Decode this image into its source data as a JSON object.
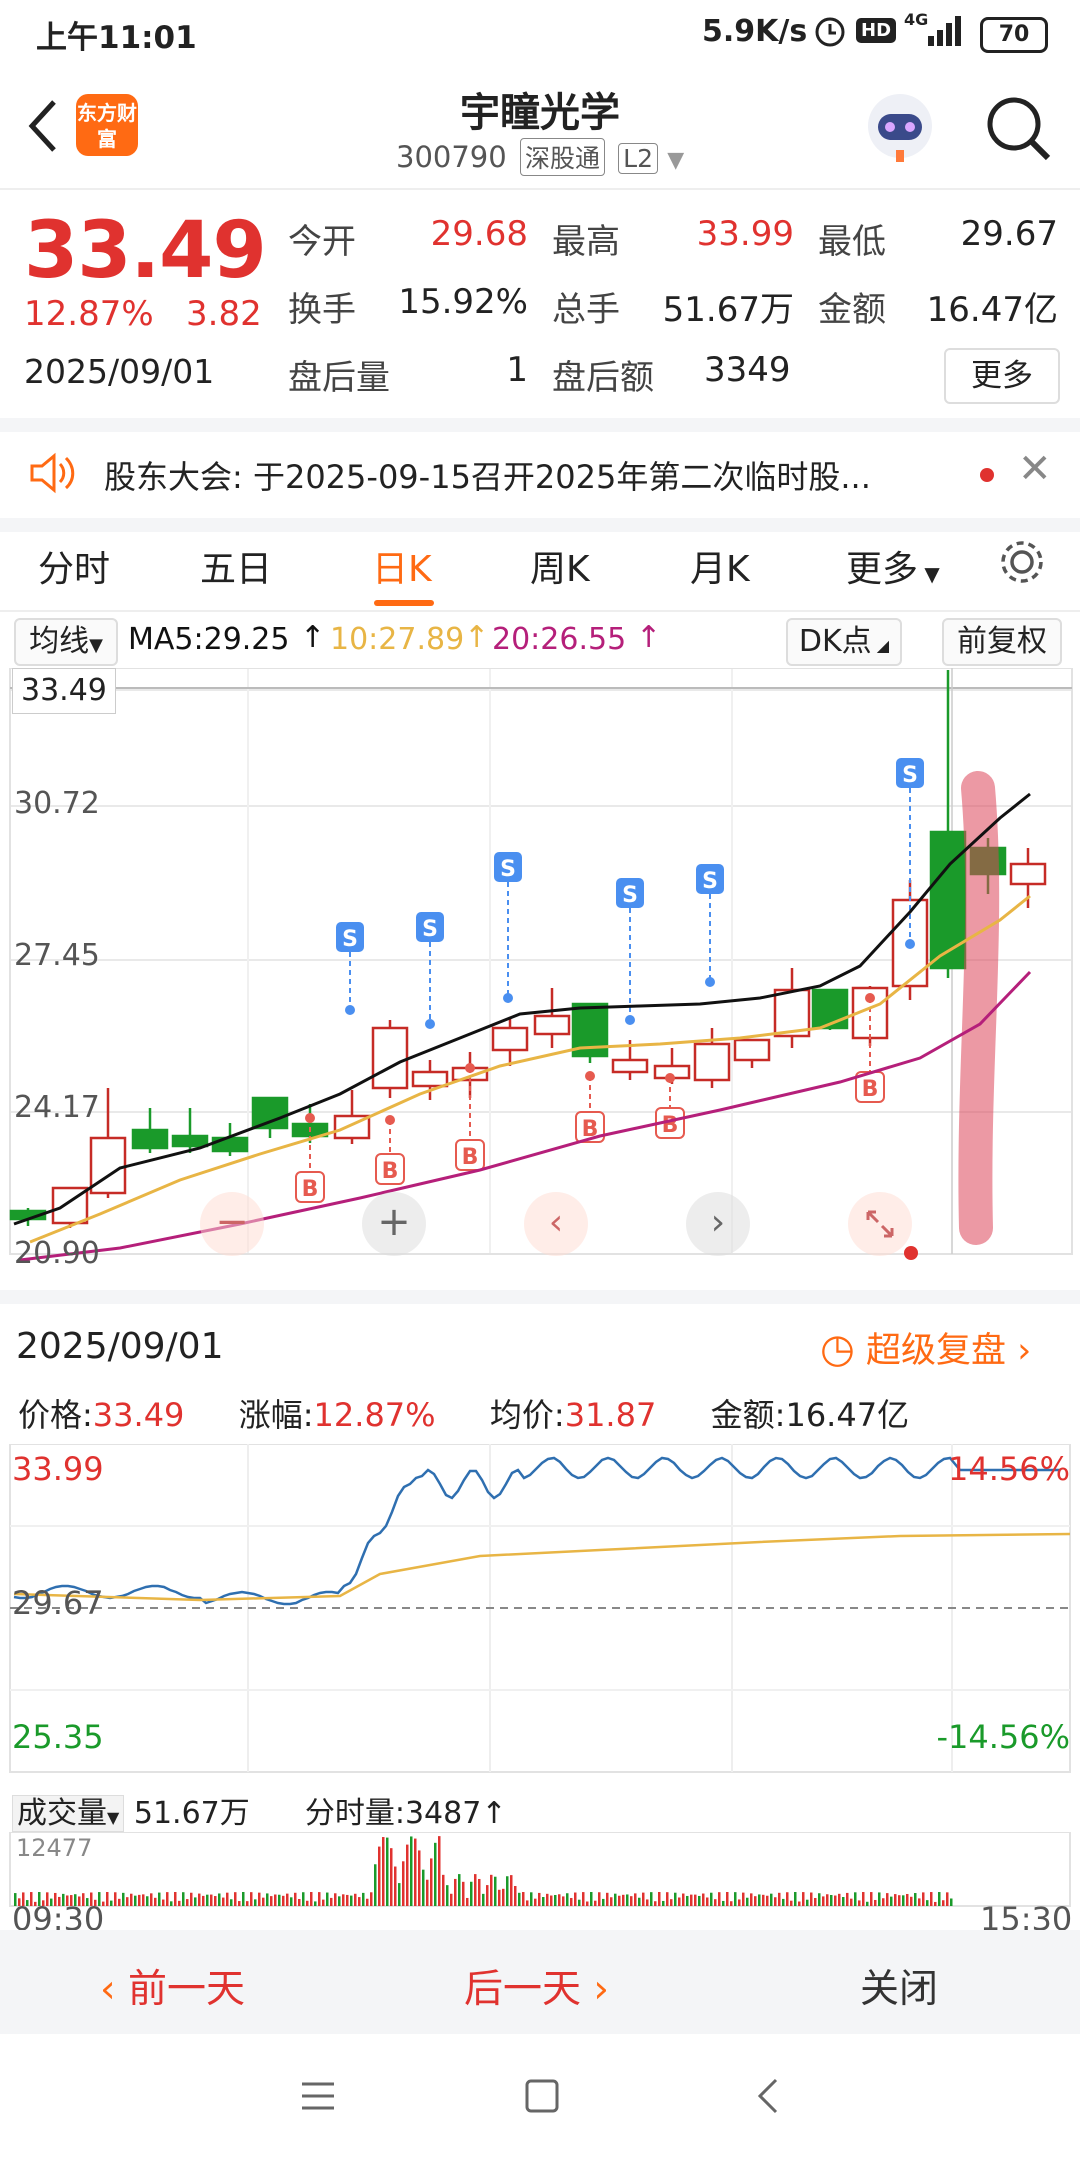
{
  "status_bar": {
    "time": "上午11:01",
    "net_speed": "5.9K/s",
    "hd": "HD",
    "network": "4G",
    "battery": "70"
  },
  "header": {
    "logo_text": "东方财富",
    "title": "宇瞳光学",
    "code": "300790",
    "tag_connect": "深股通",
    "tag_level": "L2"
  },
  "quote": {
    "price": "33.49",
    "change_pct": "12.87%",
    "change": "3.82",
    "date": "2025/09/01",
    "open_label": "今开",
    "open": "29.68",
    "high_label": "最高",
    "high": "33.99",
    "low_label": "最低",
    "low": "29.67",
    "turnover_label": "换手",
    "turnover": "15.92%",
    "volume_label": "总手",
    "volume": "51.67万",
    "amount_label": "金额",
    "amount": "16.47亿",
    "after_vol_label": "盘后量",
    "after_vol": "1",
    "after_amt_label": "盘后额",
    "after_amt": "3349",
    "more": "更多"
  },
  "notice": {
    "text": "股东大会: 于2025-09-15召开2025年第二次临时股..."
  },
  "tabs": [
    {
      "label": "分时"
    },
    {
      "label": "五日"
    },
    {
      "label": "日K"
    },
    {
      "label": "周K"
    },
    {
      "label": "月K"
    },
    {
      "label": "更多"
    }
  ],
  "ma_row": {
    "select": "均线",
    "ma5": "MA5:29.25",
    "ma10": "10:27.89",
    "ma20": "20:26.55",
    "dk": "DK点",
    "adjust": "前复权"
  },
  "kchart": {
    "yticks": [
      "33.49",
      "30.72",
      "27.45",
      "24.17",
      "20.90"
    ],
    "buy_label": "B",
    "sell_label": "S"
  },
  "timeline": {
    "date": "2025/09/01",
    "replay": "超级复盘",
    "price_label": "价格:",
    "price": "33.49",
    "pct_label": "涨幅:",
    "pct": "12.87%",
    "avg_label": "均价:",
    "avg": "31.87",
    "amt_label": "金额:",
    "amt": "16.47亿",
    "y_high": "33.99",
    "y_mid": "29.67",
    "y_low": "25.35",
    "pct_high": "14.56%",
    "pct_low": "-14.56%",
    "vol_select": "成交量",
    "vol_total": "51.67万",
    "min_vol": "分时量:3487",
    "vol_max": "12477",
    "t_start": "09:30",
    "t_end": "15:30"
  },
  "bottom_nav": {
    "prev": "前一天",
    "next": "后一天",
    "close": "关闭"
  },
  "colors": {
    "up": "#e0322f",
    "down": "#1a9a2a",
    "accent": "#ff6a13",
    "ma5": "#111111",
    "ma10": "#e8b545",
    "ma20": "#b51f7a"
  },
  "chart_data": {
    "type": "candlestick",
    "ma5": "29.25",
    "ma10": "27.89",
    "ma20": "26.55",
    "ylim": [
      20.9,
      33.49
    ]
  }
}
